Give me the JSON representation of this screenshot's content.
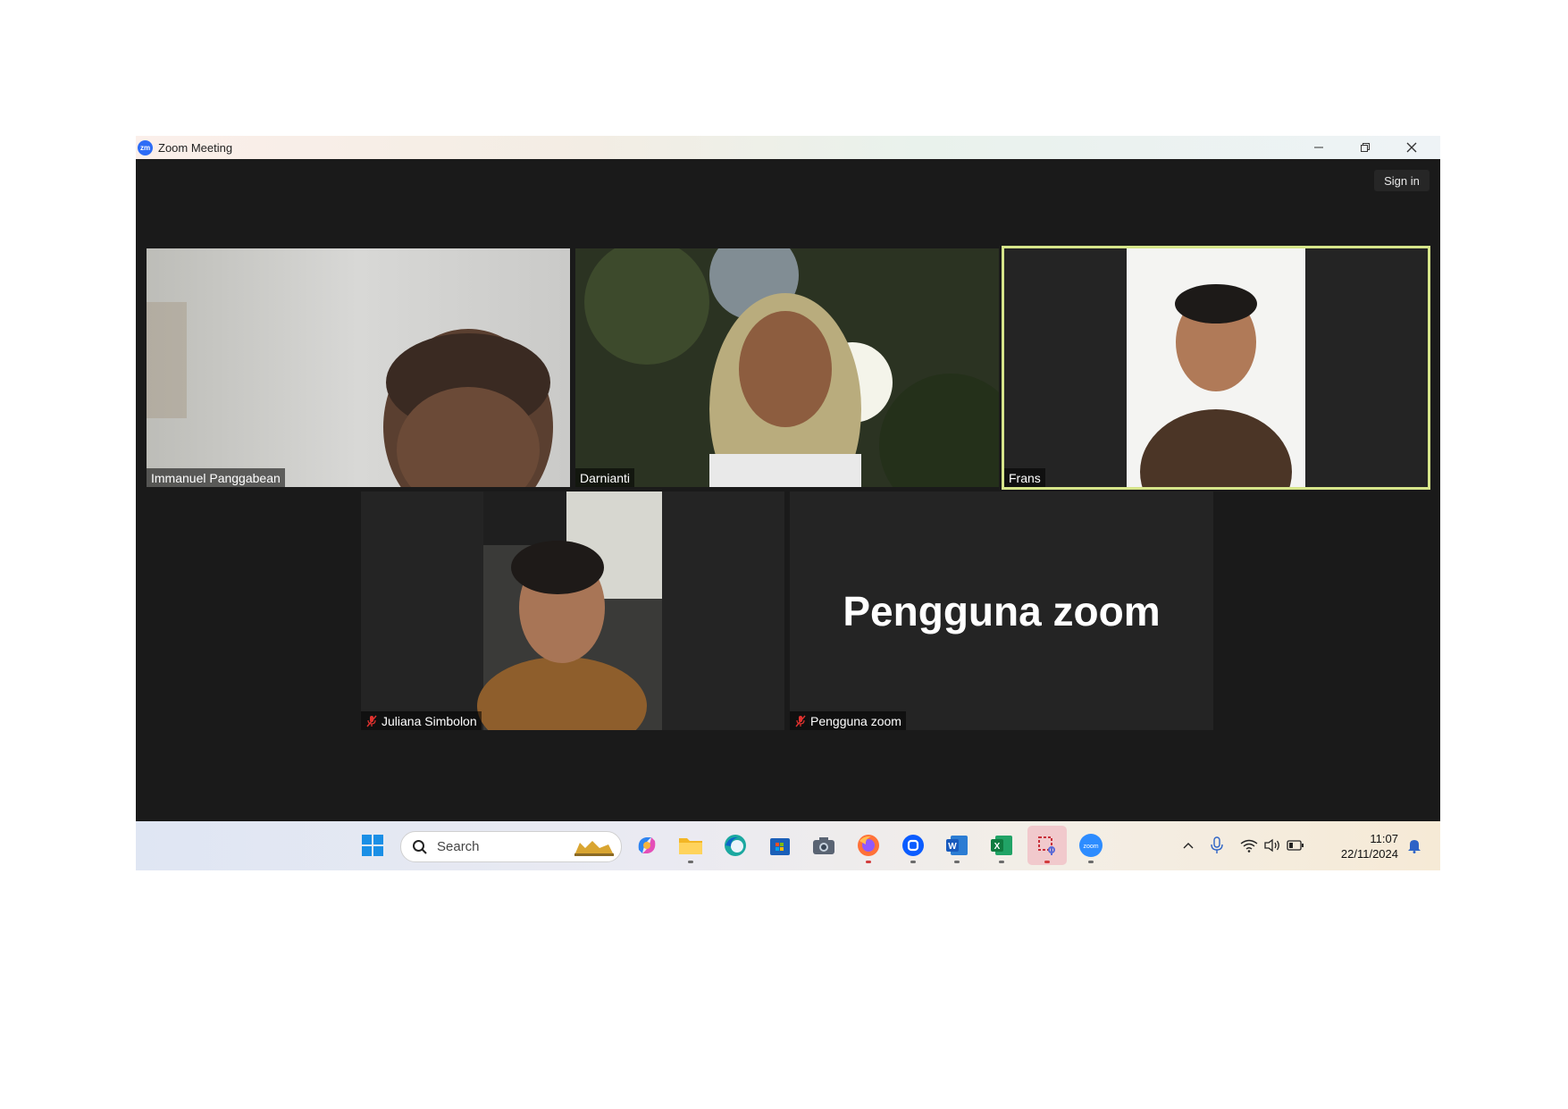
{
  "window": {
    "title": "Zoom Meeting"
  },
  "meeting": {
    "signin_label": "Sign in",
    "participants": [
      {
        "name": "Immanuel Panggabean",
        "muted": false
      },
      {
        "name": "Darnianti",
        "muted": false
      },
      {
        "name": "Frans",
        "muted": false,
        "active_speaker": true
      },
      {
        "name": "Juliana Simbolon",
        "muted": true
      },
      {
        "name": "Pengguna zoom",
        "muted": true,
        "display_name": "Pengguna zoom"
      }
    ]
  },
  "taskbar": {
    "search_placeholder": "Search",
    "apps": [
      "windows-start",
      "search",
      "copilot",
      "file-explorer",
      "edge",
      "microsoft-store",
      "camera",
      "firefox",
      "zoom-workplace",
      "word",
      "excel",
      "snipping-tool",
      "zoom"
    ],
    "time": "11:07",
    "date": "22/11/2024"
  },
  "colors": {
    "active_border": "#d6e58a",
    "meeting_bg": "#1a1a1a",
    "tile_bg": "#242424"
  }
}
